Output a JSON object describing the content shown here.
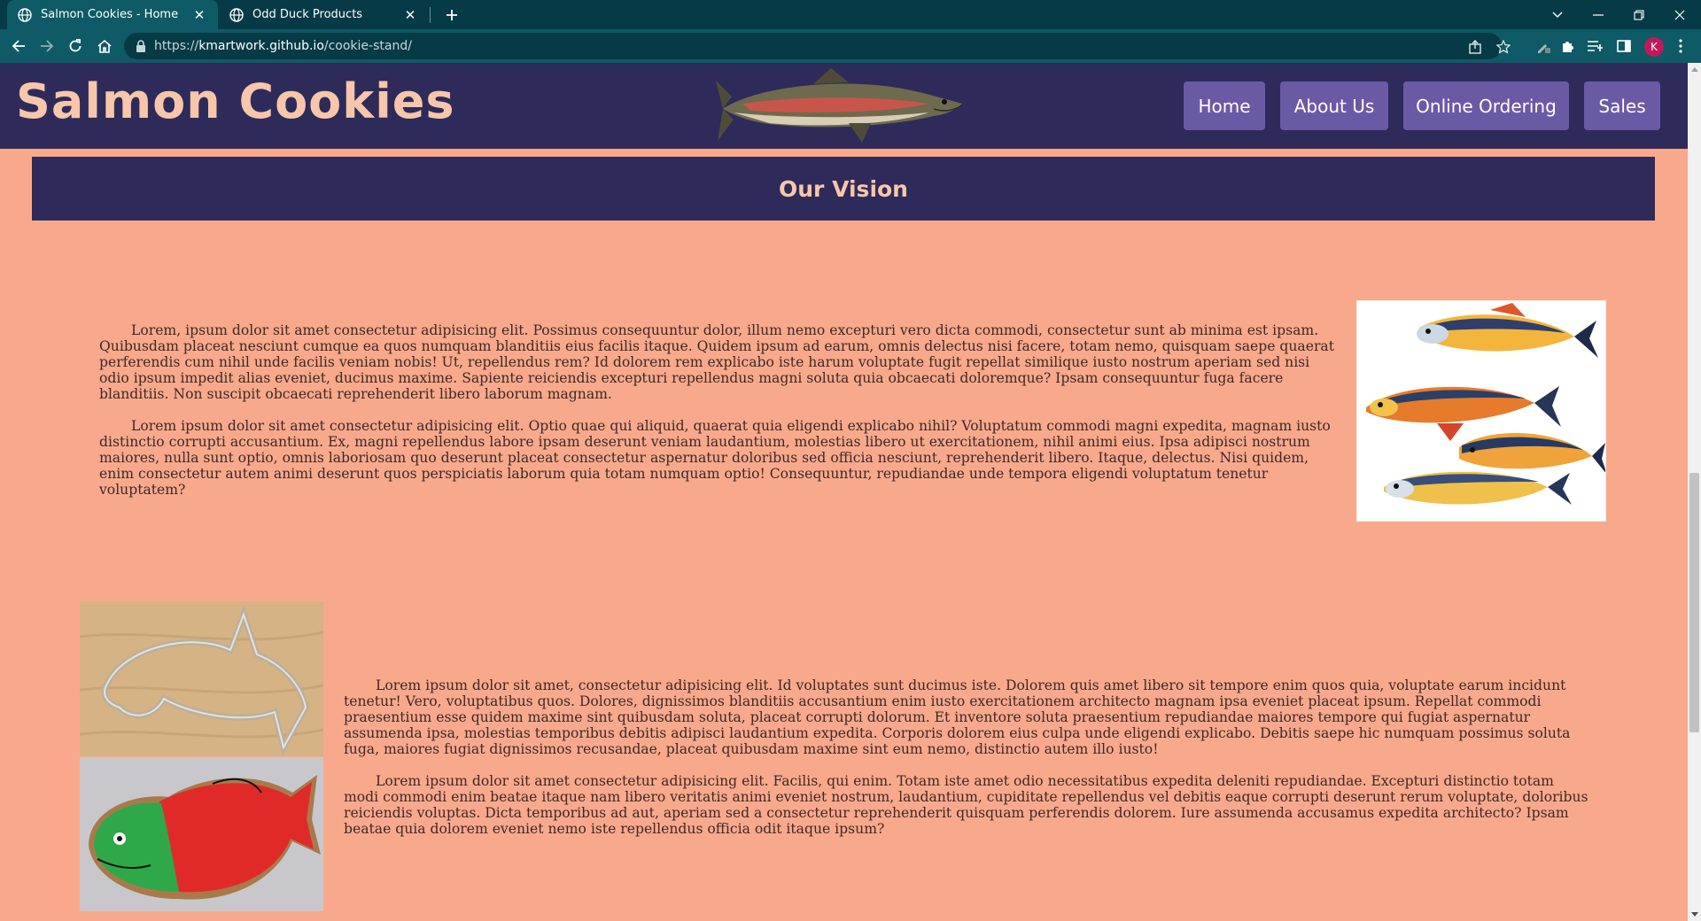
{
  "browser": {
    "tabs": [
      {
        "title": "Salmon Cookies - Home",
        "active": true
      },
      {
        "title": "Odd Duck Products",
        "active": false
      }
    ],
    "url_prefix": "https://",
    "url_host": "kmartwork.github.io",
    "url_path": "/cookie-stand/",
    "profile_initial": "K",
    "accent_color": "#0e5a66"
  },
  "site": {
    "title": "Salmon Cookies",
    "nav": [
      {
        "label": "Home"
      },
      {
        "label": "About Us"
      },
      {
        "label": "Online Ordering"
      },
      {
        "label": "Sales"
      }
    ],
    "header_color": "#2e2b5a",
    "page_color": "#f9a98b",
    "nav_color": "#6a5aa6"
  },
  "vision": {
    "heading": "Our Vision"
  },
  "section1": {
    "paragraphs": [
      "Lorem, ipsum dolor sit amet consectetur adipisicing elit. Possimus consequuntur dolor, illum nemo excepturi vero dicta commodi, consectetur sunt ab minima est ipsam. Quibusdam placeat nesciunt cumque ea quos numquam blanditiis eius facilis itaque. Quidem ipsum ad earum, omnis delectus nisi facere, totam nemo, quisquam saepe quaerat perferendis cum nihil unde facilis veniam nobis! Ut, repellendus rem? Id dolorem rem explicabo iste harum voluptate fugit repellat similique iusto nostrum aperiam sed nisi odio ipsum impedit alias eveniet, ducimus maxime. Sapiente reiciendis excepturi repellendus magni soluta quia obcaecati doloremque? Ipsam consequuntur fuga facere blanditiis. Non suscipit obcaecati reprehenderit libero laborum magnam.",
      "Lorem ipsum dolor sit amet consectetur adipisicing elit. Optio quae qui aliquid, quaerat quia eligendi explicabo nihil? Voluptatum commodi magni expedita, magnam iusto distinctio corrupti accusantium. Ex, magni repellendus labore ipsam deserunt veniam laudantium, molestias libero ut exercitationem, nihil animi eius. Ipsa adipisci nostrum maiores, nulla sunt optio, omnis laboriosam quo deserunt placeat consectetur aspernatur doloribus sed officia nesciunt, reprehenderit libero. Itaque, delectus. Nisi quidem, enim consectetur autem animi deserunt quos perspiciatis laborum quia totam numquam optio! Consequuntur, repudiandae unde tempora eligendi voluptatum tenetur voluptatem?"
    ]
  },
  "section2": {
    "paragraphs": [
      "Lorem ipsum dolor sit amet, consectetur adipisicing elit. Id voluptates sunt ducimus iste. Dolorem quis amet libero sit tempore enim quos quia, voluptate earum incidunt tenetur! Vero, voluptatibus quos. Dolores, dignissimos blanditiis accusantium enim iusto exercitationem architecto magnam ipsa eveniet placeat ipsum. Repellat commodi praesentium esse quidem maxime sint quibusdam soluta, placeat corrupti dolorum. Et inventore soluta praesentium repudiandae maiores tempore qui fugiat aspernatur assumenda ipsa, molestias temporibus debitis adipisci laudantium expedita. Corporis dolorem eius culpa unde eligendi explicabo. Debitis saepe hic numquam possimus soluta fuga, maiores fugiat dignissimos recusandae, placeat quibusdam maxime sint eum nemo, distinctio autem illo iusto!",
      "Lorem ipsum dolor sit amet consectetur adipisicing elit. Facilis, qui enim. Totam iste amet odio necessitatibus expedita deleniti repudiandae. Excepturi distinctio totam modi commodi enim beatae itaque nam libero veritatis animi eveniet nostrum, laudantium, cupiditate repellendus vel debitis eaque corrupti deserunt rerum voluptate, doloribus reiciendis voluptas. Dicta temporibus ad aut, aperiam sed a consectetur reprehenderit quisquam perferendis dolorem. Iure assumenda accusamus expedita architecto? Ipsam beatae quia dolorem eveniet nemo iste repellendus officia odit itaque ipsum?"
    ]
  },
  "icons": {
    "back": "arrow-left-icon",
    "forward": "arrow-right-icon",
    "reload": "reload-icon",
    "home": "home-icon",
    "lock": "lock-icon",
    "share": "share-icon",
    "bookmark": "star-icon",
    "extensions": "puzzle-icon",
    "reading_list": "reading-list-icon",
    "side_panel": "side-panel-icon",
    "menu": "kebab-menu-icon"
  }
}
